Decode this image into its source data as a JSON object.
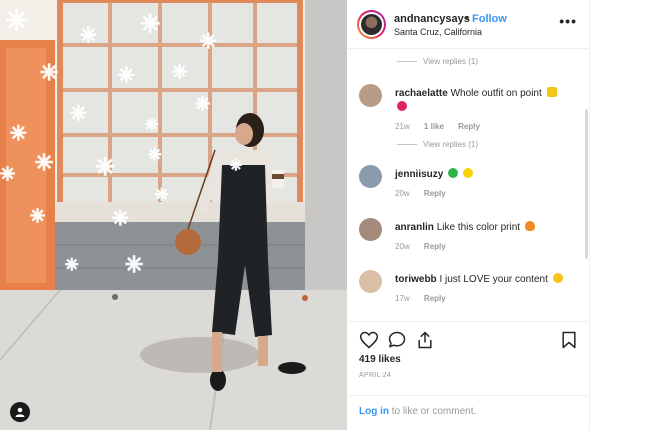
{
  "post": {
    "author": "andnancysays",
    "separator": "•",
    "follow_label": "Follow",
    "location": "Santa Cruz, California",
    "more_label": "•••",
    "likes": "419 likes",
    "date": "APRIL 24"
  },
  "comments": [
    {
      "username": "rachaelatte",
      "text": "Whole outfit on point",
      "emoji": [
        "sparkles",
        "red-heart"
      ],
      "age": "21w",
      "likes": "1 like",
      "reply_label": "Reply",
      "avatar_color": "#b89c86"
    },
    {
      "username": "jenniisuzy",
      "text": "",
      "emoji": [
        "green-heart",
        "yellow-heart"
      ],
      "age": "20w",
      "likes": "",
      "reply_label": "Reply",
      "avatar_color": "#8a9bb0"
    },
    {
      "username": "anranlin",
      "text": "Like this color print",
      "emoji": [
        "fire"
      ],
      "age": "20w",
      "likes": "",
      "reply_label": "Reply",
      "avatar_color": "#a48a7a"
    },
    {
      "username": "toriwebb",
      "text": "I just LOVE your content",
      "emoji": [
        "heart-eyes"
      ],
      "age": "17w",
      "likes": "",
      "reply_label": "Reply",
      "avatar_color": "#d8bfa6"
    }
  ],
  "view_replies": [
    {
      "label": "View replies (1)"
    },
    {
      "label": "View replies (1)"
    }
  ],
  "footer": {
    "login_label": "Log in",
    "login_suffix": " to like or comment."
  },
  "icons": {
    "like": "heart-icon",
    "comment": "comment-bubble-icon",
    "share": "share-icon",
    "save": "bookmark-icon",
    "user_tag": "user-tag-icon"
  },
  "colors": {
    "accent": "#3897f0",
    "door": "#e8804a",
    "window_frame": "#e08a5c"
  }
}
